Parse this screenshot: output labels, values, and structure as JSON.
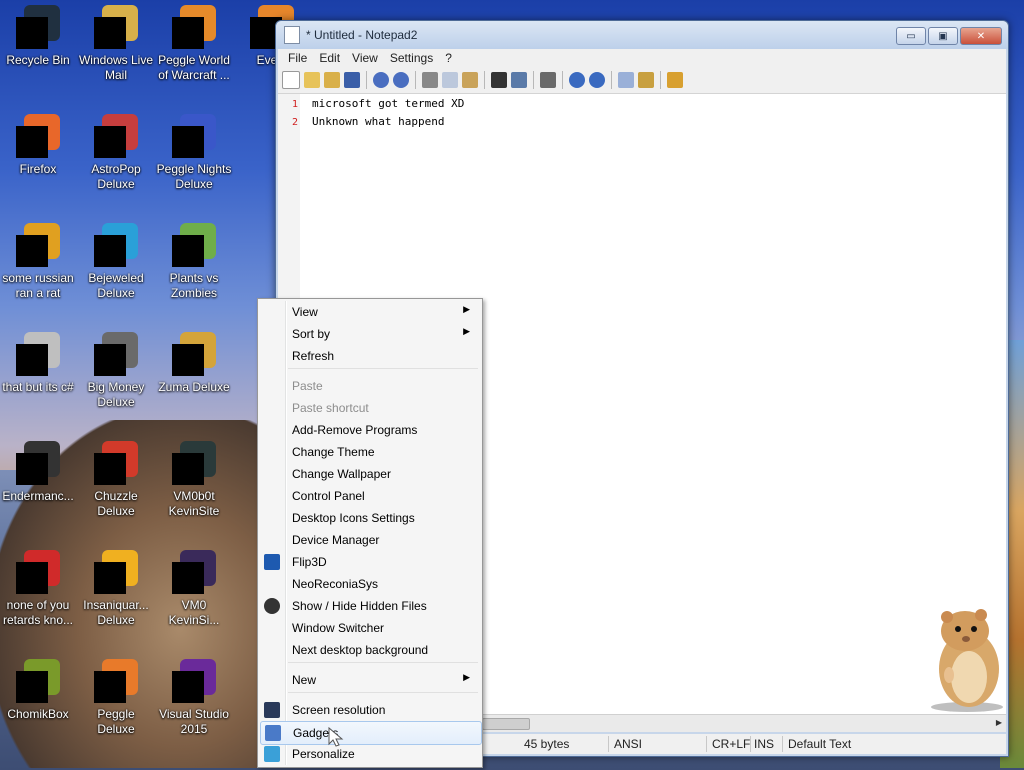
{
  "desktop": {
    "icons": [
      {
        "label": "Recycle Bin",
        "color": "#203040"
      },
      {
        "label": "Windows Live Mail",
        "color": "#d7b04a"
      },
      {
        "label": "Peggle World of Warcraft ...",
        "color": "#e58a2a"
      },
      {
        "label": "Every",
        "color": "#e6862b"
      },
      {
        "label": "Firefox",
        "color": "#e8672a"
      },
      {
        "label": "AstroPop Deluxe",
        "color": "#c63e3e"
      },
      {
        "label": "Peggle Nights Deluxe",
        "color": "#3a57c9"
      },
      {
        "label": "some russian ran a rat",
        "color": "#e0a020"
      },
      {
        "label": "Bejeweled Deluxe",
        "color": "#2aa0d8"
      },
      {
        "label": "Plants vs Zombies",
        "color": "#6fae4a"
      },
      {
        "label": "that but its c#",
        "color": "#bfbfbf"
      },
      {
        "label": "Big Money Deluxe",
        "color": "#6a6a6a"
      },
      {
        "label": "Zuma Deluxe",
        "color": "#d4a43a"
      },
      {
        "label": "Endermanc...",
        "color": "#333333"
      },
      {
        "label": "Chuzzle Deluxe",
        "color": "#d23a2a"
      },
      {
        "label": "VM0b0t KevinSite",
        "color": "#2a3a3a"
      },
      {
        "label": "none of you retards kno...",
        "color": "#d02a2a"
      },
      {
        "label": "Insaniquar... Deluxe",
        "color": "#f0b020"
      },
      {
        "label": "VM0 KevinSi...",
        "color": "#3a2a5a"
      },
      {
        "label": "ChomikBox",
        "color": "#7a9a2a"
      },
      {
        "label": "Peggle Deluxe",
        "color": "#e87a2a"
      },
      {
        "label": "Visual Studio 2015",
        "color": "#6a2a9a"
      }
    ]
  },
  "notepad": {
    "title": "* Untitled - Notepad2",
    "menu": [
      "File",
      "Edit",
      "View",
      "Settings",
      "?"
    ],
    "lines": [
      {
        "num": "1",
        "text": "microsoft got termed XD"
      },
      {
        "num": "2",
        "text": "Unknown what happend"
      }
    ],
    "status": {
      "size": "45 bytes",
      "encoding": "ANSI",
      "eol": "CR+LF",
      "mode": "INS",
      "scheme": "Default Text"
    },
    "window_buttons": {
      "min": "▭",
      "max": "▣",
      "close": "✕"
    }
  },
  "context_menu": {
    "items": [
      {
        "label": "View",
        "sub": true
      },
      {
        "label": "Sort by",
        "sub": true
      },
      {
        "label": "Refresh"
      },
      {
        "label": "Paste",
        "disabled": true
      },
      {
        "label": "Paste shortcut",
        "disabled": true
      },
      {
        "label": "Add-Remove Programs"
      },
      {
        "label": "Change Theme"
      },
      {
        "label": "Change Wallpaper"
      },
      {
        "label": "Control Panel"
      },
      {
        "label": "Desktop Icons Settings"
      },
      {
        "label": "Device Manager"
      },
      {
        "label": "Flip3D",
        "icon": "flip3d-icon"
      },
      {
        "label": "NeoReconiaSys"
      },
      {
        "label": "Show / Hide Hidden Files",
        "icon": "hidden-files-icon"
      },
      {
        "label": "Window Switcher"
      },
      {
        "label": "Next desktop background"
      },
      {
        "label": "New",
        "sub": true
      },
      {
        "label": "Screen resolution",
        "icon": "screen-resolution-icon"
      },
      {
        "label": "Gadgets",
        "icon": "gadgets-icon",
        "hover": true
      },
      {
        "label": "Personalize",
        "icon": "personalize-icon"
      }
    ],
    "arrow": "▶"
  }
}
